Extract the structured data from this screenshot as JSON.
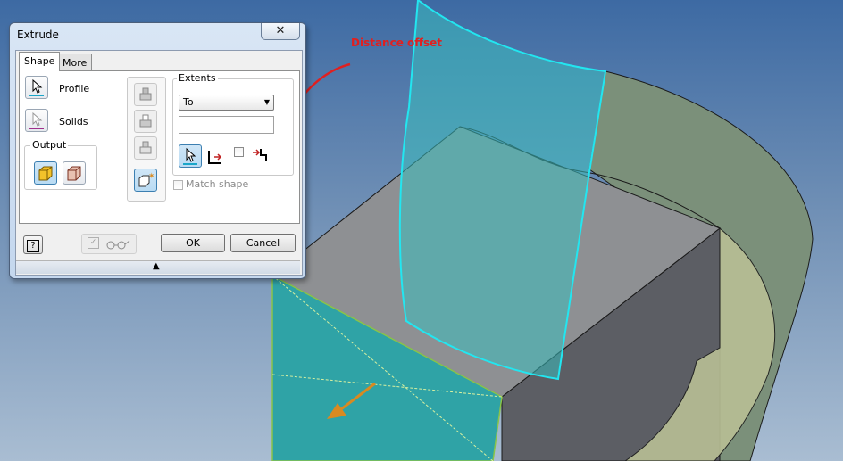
{
  "dialog": {
    "title": "Extrude",
    "close_glyph": "✕",
    "tabs": [
      {
        "label": "Shape",
        "active": true
      },
      {
        "label": "More",
        "active": false
      }
    ],
    "profile_label": "Profile",
    "solids_label": "Solids",
    "output_label": "Output",
    "extents_label": "Extents",
    "extents_value": "To",
    "distance_value": "",
    "match_shape_label": "Match shape",
    "ok_label": "OK",
    "cancel_label": "Cancel",
    "help_glyph": "?",
    "splitter_glyph": "▲"
  },
  "annotation": {
    "label": "Distance offset",
    "color": "#e02020"
  },
  "colors": {
    "surface_teal": "#3aa6a4",
    "face_top": "#8e9093",
    "face_right": "#5c5e64",
    "cyan_edge": "#22e6f0",
    "arrow": "#d98a20"
  }
}
